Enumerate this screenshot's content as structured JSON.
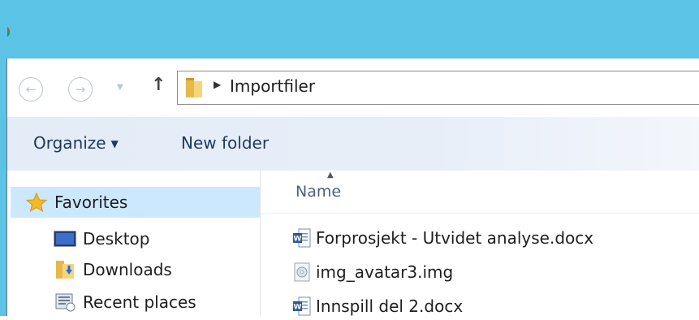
{
  "address": {
    "breadcrumb": "Importfiler"
  },
  "toolbar": {
    "organize_label": "Organize",
    "new_folder_label": "New folder"
  },
  "navigation": {
    "favorites_label": "Favorites",
    "items": [
      {
        "label": "Desktop",
        "icon": "desktop-icon"
      },
      {
        "label": "Downloads",
        "icon": "downloads-folder-icon"
      },
      {
        "label": "Recent places",
        "icon": "recent-places-icon"
      }
    ]
  },
  "file_list": {
    "column_name": "Name",
    "files": [
      {
        "name": "Forprosjekt - Utvidet analyse.docx",
        "icon": "word-document-icon"
      },
      {
        "name": "img_avatar3.img",
        "icon": "disc-image-icon"
      },
      {
        "name": "Innspill del 2.docx",
        "icon": "word-document-icon"
      }
    ]
  },
  "colors": {
    "titlebar": "#5bc3e6",
    "commandbar": "#e5edf8",
    "selection": "#cce8ff",
    "command_text": "#1e395b"
  }
}
